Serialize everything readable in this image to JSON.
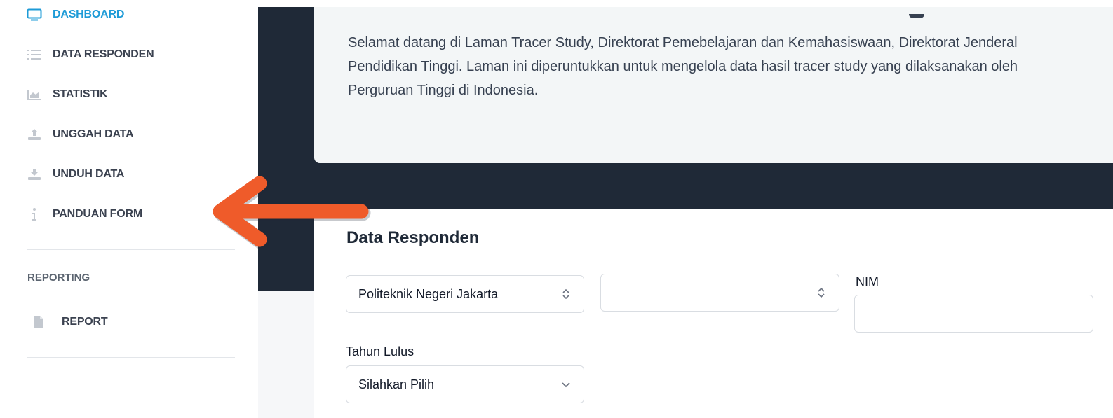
{
  "sidebar": {
    "items": [
      {
        "label": "DASHBOARD",
        "icon": "monitor-icon",
        "active": true
      },
      {
        "label": "DATA RESPONDEN",
        "icon": "list-icon"
      },
      {
        "label": "STATISTIK",
        "icon": "area-chart-icon"
      },
      {
        "label": "UNGGAH DATA",
        "icon": "upload-icon"
      },
      {
        "label": "UNDUH DATA",
        "icon": "download-icon"
      },
      {
        "label": "PANDUAN FORM",
        "icon": "info-icon"
      }
    ],
    "section_title": "REPORTING",
    "report_item": {
      "label": "REPORT",
      "icon": "document-icon"
    }
  },
  "welcome": {
    "text": "Selamat datang di Laman Tracer Study, Direktorat Pemebelajaran dan Kemahasiswaan, Direktorat Jenderal Pendidikan Tinggi. Laman ini diperuntukkan untuk mengelola data hasil tracer study yang dilaksanakan oleh Perguruan Tinggi di Indonesia."
  },
  "form": {
    "title": "Data Responden",
    "institution_select": {
      "value": "Politeknik Negeri Jakarta"
    },
    "program_select": {
      "value": ""
    },
    "nim_label": "NIM",
    "nim_input": {
      "value": ""
    },
    "tahun_label": "Tahun Lulus",
    "tahun_select": {
      "value": "Silahkan Pilih"
    }
  },
  "colors": {
    "accent": "#1e9bd7",
    "arrow": "#ef5b2a",
    "dark_header": "#1f2937"
  }
}
